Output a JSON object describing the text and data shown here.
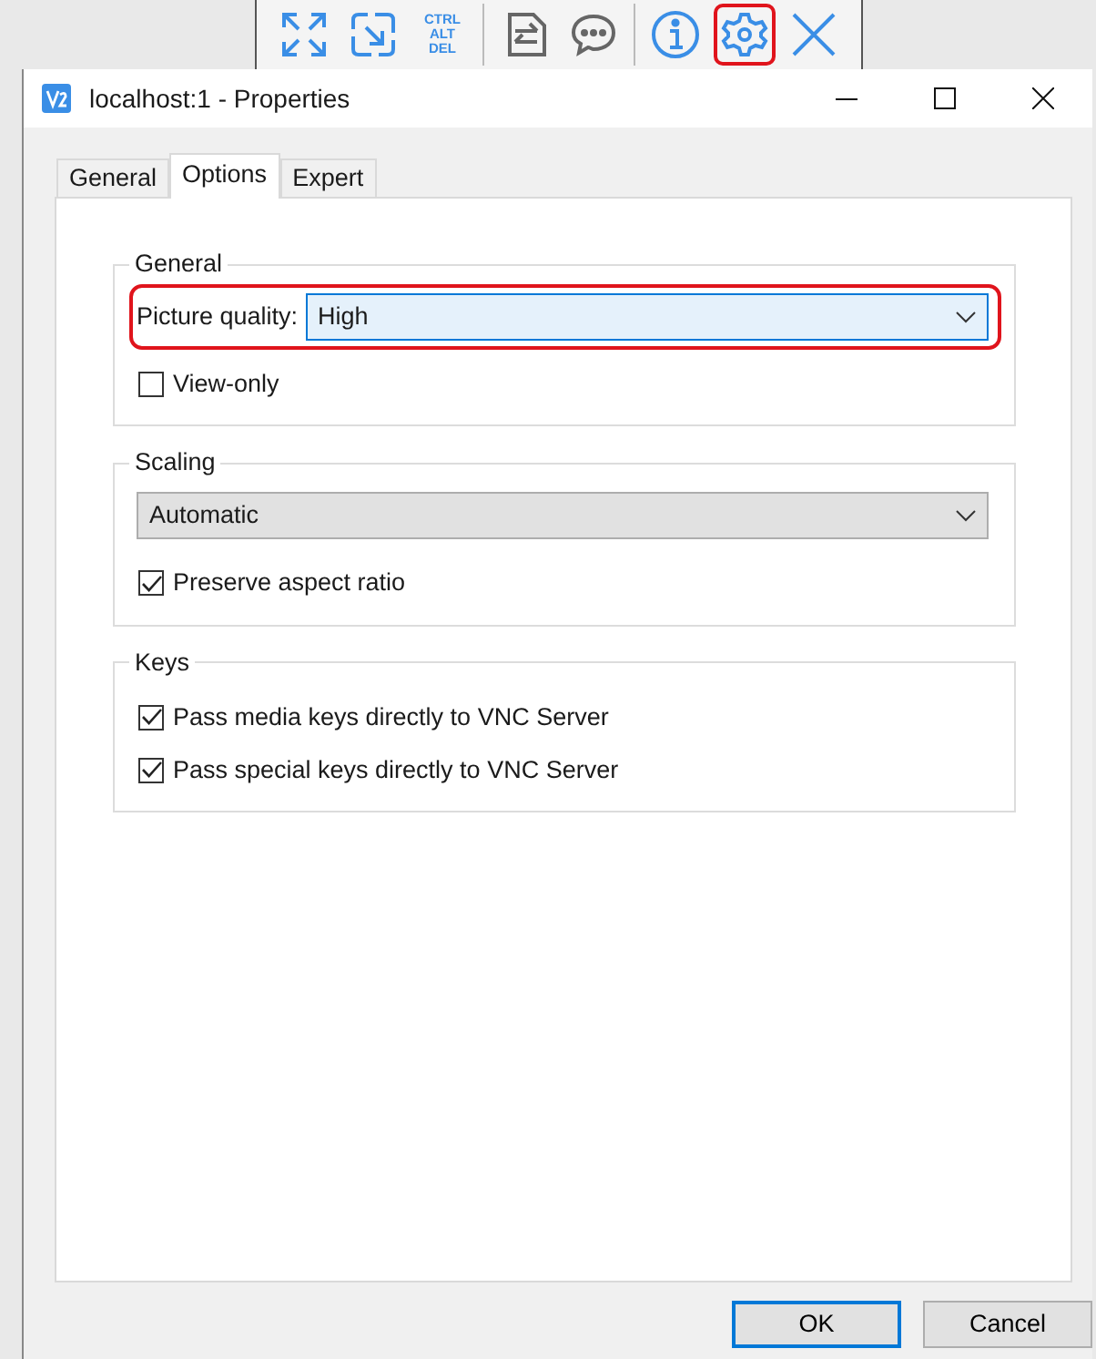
{
  "toolbar": {
    "groups": [
      [
        {
          "kind": "fullscreen",
          "highlighted": false
        },
        {
          "kind": "scale",
          "highlighted": false
        },
        {
          "kind": "keys",
          "lines": [
            "CTRL",
            "ALT",
            "DEL"
          ],
          "highlighted": false
        }
      ],
      [
        {
          "kind": "transfer",
          "highlighted": false
        },
        {
          "kind": "chat",
          "highlighted": false
        }
      ],
      [
        {
          "kind": "info",
          "highlighted": false
        },
        {
          "kind": "settings",
          "highlighted": true
        },
        {
          "kind": "close",
          "highlighted": false
        }
      ]
    ]
  },
  "window": {
    "title": "localhost:1 - Properties"
  },
  "tabs": [
    {
      "label": "General",
      "selected": false
    },
    {
      "label": "Options",
      "selected": true
    },
    {
      "label": "Expert",
      "selected": false
    }
  ],
  "sections": [
    {
      "title": "General",
      "rows": [
        {
          "kind": "select",
          "label": "Picture quality:",
          "value": "High",
          "focused": true,
          "highlighted": true
        },
        {
          "kind": "checkbox",
          "label": "View-only",
          "checked": false
        }
      ]
    },
    {
      "title": "Scaling",
      "rows": [
        {
          "kind": "select",
          "value": "Automatic",
          "focused": false,
          "highlighted": false
        },
        {
          "kind": "checkbox",
          "label": "Preserve aspect ratio",
          "checked": true
        }
      ]
    },
    {
      "title": "Keys",
      "rows": [
        {
          "kind": "checkbox",
          "label": "Pass media keys directly to VNC Server",
          "checked": true
        },
        {
          "kind": "checkbox",
          "label": "Pass special keys directly to VNC Server",
          "checked": true
        }
      ]
    }
  ],
  "buttons": [
    {
      "label": "OK",
      "default": true
    },
    {
      "label": "Cancel",
      "default": false
    }
  ]
}
